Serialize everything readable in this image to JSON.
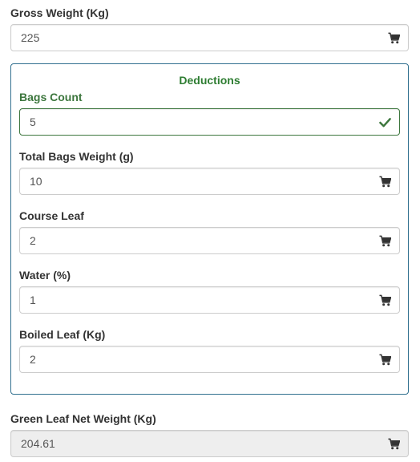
{
  "gross_weight": {
    "label": "Gross Weight (Kg)",
    "value": "225"
  },
  "deductions": {
    "title": "Deductions",
    "bags_count": {
      "label": "Bags Count",
      "value": "5"
    },
    "total_bags_weight": {
      "label": "Total Bags Weight (g)",
      "value": "10"
    },
    "course_leaf": {
      "label": "Course Leaf",
      "value": "2"
    },
    "water": {
      "label": "Water (%)",
      "value": "1"
    },
    "boiled_leaf": {
      "label": "Boiled Leaf (Kg)",
      "value": "2"
    }
  },
  "net_weight": {
    "label": "Green Leaf Net Weight (Kg)",
    "value": "204.61"
  },
  "icons": {
    "field_icon": "shopping-cart-icon",
    "valid_icon": "checkmark-icon"
  },
  "colors": {
    "success": "#3c763d",
    "fieldset_border": "#31708f",
    "legend": "#2e7d32"
  }
}
